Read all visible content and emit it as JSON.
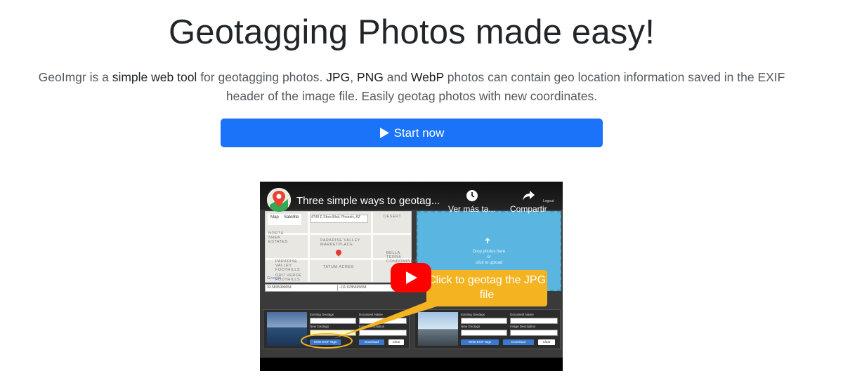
{
  "header": {
    "title": "Geotagging Photos made easy!",
    "lead_1": "GeoImgr is a ",
    "lead_2": "simple web tool",
    "lead_3": " for geotagging photos. ",
    "lead_4": "JPG",
    "lead_5": ", ",
    "lead_6": "PNG",
    "lead_7": " and ",
    "lead_8": "WebP",
    "lead_9": " photos can contain geo location information saved in the EXIF header of the image file. Easily geotag photos with new coordinates."
  },
  "cta": {
    "label": "Start now",
    "icon": "play-icon",
    "color": "#1a73f8"
  },
  "video": {
    "title": "Three simple ways to geotag...",
    "watch_later_label": "Ver más ta...",
    "share_label": "Compartir",
    "logout_label": "Logout",
    "map_tab_map": "Map",
    "map_tab_satellite": "Satellite",
    "map_address": "4740 E Shea Blvd, Phoenix, AZ",
    "map_labels": [
      "NORTH SHEA ESTATES",
      "PARADISE VALLEY MARKETPLACE",
      "PARADISE VALLEY FOOTHILLS",
      "TATUM ACRES",
      "ORO VERDE FOOTHILLS",
      "BELLA TERRA CONDOMINIUMS",
      "DESERT",
      "Google"
    ],
    "drop_text_1": "Drop photos here",
    "drop_text_2": "or",
    "drop_text_3": "click to upload",
    "lat_value": "33.5835990654",
    "lng_value": "-111.9785695658",
    "card_labels": {
      "existing": "Existing Geotags",
      "new": "New Geotags",
      "doc_name": "Document Name",
      "img_desc": "Image Description"
    },
    "btn_write": "Write EXIF Tags",
    "btn_download": "Download",
    "btn_clear": "Clear",
    "callout_text": "Click to geotag the JPG file",
    "play_color": "#ff0000"
  }
}
